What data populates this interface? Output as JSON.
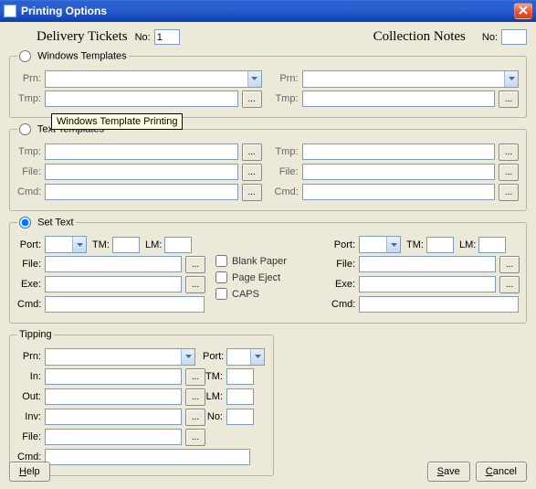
{
  "window": {
    "title": "Printing Options"
  },
  "header": {
    "delivery_title": "Delivery Tickets",
    "delivery_no_label": "No:",
    "delivery_no_value": "1",
    "collection_title": "Collection Notes",
    "collection_no_label": "No:",
    "collection_no_value": ""
  },
  "groups": {
    "windows": {
      "legend": "Windows Templates",
      "selected": false,
      "left": {
        "prn_label": "Prn:",
        "prn_value": "",
        "tmp_label": "Tmp:",
        "tmp_value": ""
      },
      "right": {
        "prn_label": "Prn:",
        "prn_value": "",
        "tmp_label": "Tmp:",
        "tmp_value": ""
      },
      "browse": "...",
      "tooltip": "Windows Template Printing"
    },
    "text": {
      "legend": "Text Templates",
      "selected": false,
      "left": {
        "tmp_label": "Tmp:",
        "tmp_value": "",
        "file_label": "File:",
        "file_value": "",
        "cmd_label": "Cmd:",
        "cmd_value": ""
      },
      "right": {
        "tmp_label": "Tmp:",
        "tmp_value": "",
        "file_label": "File:",
        "file_value": "",
        "cmd_label": "Cmd:",
        "cmd_value": ""
      },
      "browse": "..."
    },
    "settext": {
      "legend": "Set Text",
      "selected": true,
      "left": {
        "port_label": "Port:",
        "port_value": "",
        "tm_label": "TM:",
        "tm_value": "",
        "lm_label": "LM:",
        "lm_value": "",
        "file_label": "File:",
        "file_value": "",
        "exe_label": "Exe:",
        "exe_value": "",
        "cmd_label": "Cmd:",
        "cmd_value": ""
      },
      "mid": {
        "blank_label": "Blank Paper",
        "blank_checked": false,
        "eject_label": "Page Eject",
        "eject_checked": false,
        "caps_label": "CAPS",
        "caps_checked": false
      },
      "right": {
        "port_label": "Port:",
        "port_value": "",
        "tm_label": "TM:",
        "tm_value": "",
        "lm_label": "LM:",
        "lm_value": "",
        "file_label": "File:",
        "file_value": "",
        "exe_label": "Exe:",
        "exe_value": "",
        "cmd_label": "Cmd:",
        "cmd_value": ""
      },
      "browse": "..."
    },
    "tipping": {
      "legend": "Tipping",
      "prn_label": "Prn:",
      "prn_value": "",
      "port_label": "Port:",
      "port_value": "",
      "in_label": "In:",
      "in_value": "",
      "out_label": "Out:",
      "out_value": "",
      "inv_label": "Inv:",
      "inv_value": "",
      "file_label": "File:",
      "file_value": "",
      "cmd_label": "Cmd:",
      "cmd_value": "",
      "tm_label": "TM:",
      "tm_value": "",
      "lm_label": "LM:",
      "lm_value": "",
      "no_label": "No:",
      "no_value": "",
      "browse": "..."
    }
  },
  "buttons": {
    "help": "Help",
    "save": "Save",
    "cancel": "Cancel"
  }
}
